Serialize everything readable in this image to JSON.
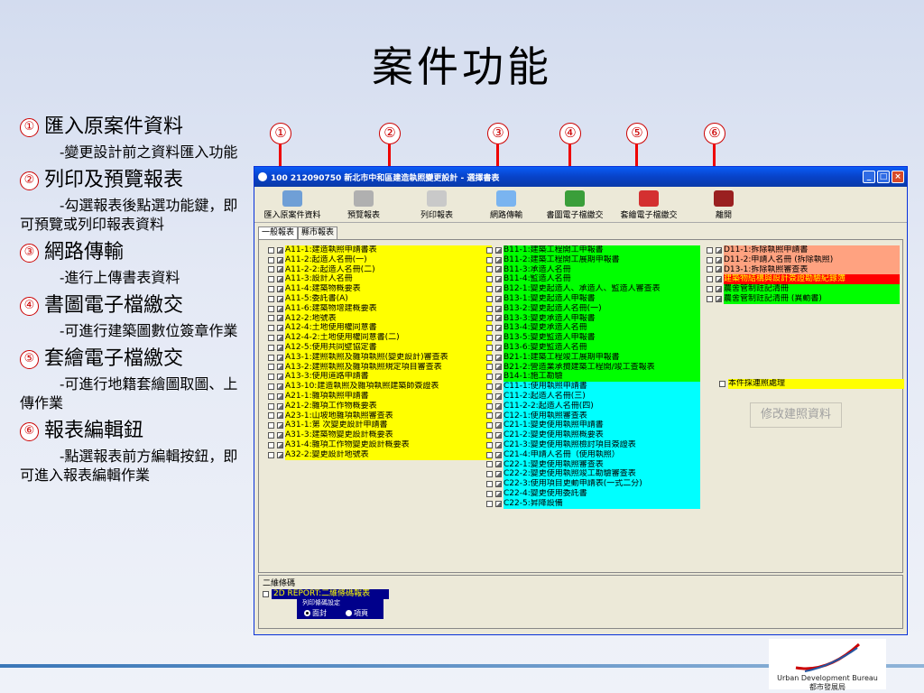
{
  "slide": {
    "title": "案件功能"
  },
  "notes": [
    {
      "num": "①",
      "heading": "匯入原案件資料",
      "desc": "-變更設計前之資料匯入功能"
    },
    {
      "num": "②",
      "heading": "列印及預覽報表",
      "desc": "-勾選報表後點選功能鍵，即可預覽或列印報表資料"
    },
    {
      "num": "③",
      "heading": "網路傳輸",
      "desc": "-進行上傳書表資料"
    },
    {
      "num": "④",
      "heading": "書圖電子檔繳交",
      "desc": "-可進行建築圖數位簽章作業"
    },
    {
      "num": "⑤",
      "heading": "套繪電子檔繳交",
      "desc": "-可進行地籍套繪圖取圖、上傳作業"
    },
    {
      "num": "⑥",
      "heading": "報表編輯鈕",
      "desc": "-點選報表前方編輯按鈕，即可進入報表編輯作業"
    }
  ],
  "callouts": [
    "①",
    "②",
    "③",
    "④",
    "⑤",
    "⑥"
  ],
  "window": {
    "title": "100 212090750 新北市中和區建造執照變更設計 - 選擇書表",
    "toolbar": [
      "匯入原案件資料",
      "預覽報表",
      "列印報表",
      "網路傳輸",
      "書圖電子檔繳交",
      "套繪電子檔繳交",
      "離開"
    ],
    "tabs": [
      "一般報表",
      "縣市報表"
    ],
    "col1": [
      {
        "text": "A11-1:建造執照申請書表",
        "color": "yellow"
      },
      {
        "text": "A11-2:起造人名冊(一)",
        "color": "yellow"
      },
      {
        "text": "A11-2-2:起造人名冊(二)",
        "color": "yellow"
      },
      {
        "text": "A11-3:設計人名冊",
        "color": "yellow"
      },
      {
        "text": "A11-4:建築物概要表",
        "color": "yellow"
      },
      {
        "text": "A11-5:委託書(A)",
        "color": "yellow"
      },
      {
        "text": "A11-6:建築物增建概要表",
        "color": "yellow"
      },
      {
        "text": "A12-2:地號表",
        "color": "yellow"
      },
      {
        "text": "A12-4:土地使用權同意書",
        "color": "yellow"
      },
      {
        "text": "A12-4-2:土地使用權同意書(二)",
        "color": "yellow"
      },
      {
        "text": "A12-5:使用共同壁協定書",
        "color": "yellow"
      },
      {
        "text": "A13-1:建照執照及雜項執照(變更設計)審查表",
        "color": "yellow"
      },
      {
        "text": "A13-2:建照執照及雜項執照規定項目審查表",
        "color": "yellow"
      },
      {
        "text": "A13-3:使用道路申請書",
        "color": "yellow"
      },
      {
        "text": "A13-10:建造執照及雜項執照建築師簽證表",
        "color": "yellow"
      },
      {
        "text": "A21-1:雜項執照申請書",
        "color": "yellow"
      },
      {
        "text": "A21-2:雜項工作物概要表",
        "color": "yellow"
      },
      {
        "text": "A23-1:山坡地雜項執照審查表",
        "color": "yellow"
      },
      {
        "text": "A31-1:第 次變更設計申請書",
        "color": "yellow"
      },
      {
        "text": "A31-3:建築物變更設計概要表",
        "color": "yellow"
      },
      {
        "text": "A31-4:雜項工作物變更設計概要表",
        "color": "yellow"
      },
      {
        "text": "A32-2:變更設計地號表",
        "color": "yellow"
      }
    ],
    "col2": [
      {
        "text": "B11-1:建築工程開工申報書",
        "color": "green"
      },
      {
        "text": "B11-2:建築工程開工展期申報書",
        "color": "green"
      },
      {
        "text": "B11-3:承造人名冊",
        "color": "green"
      },
      {
        "text": "B11-4:監造人名冊",
        "color": "green"
      },
      {
        "text": "B12-1:變更起造人、承造人、監造人審查表",
        "color": "green"
      },
      {
        "text": "B13-1:變更起造人申報書",
        "color": "green"
      },
      {
        "text": "B13-2:變更起造人名冊(一)",
        "color": "green"
      },
      {
        "text": "B13-3:變更承造人申報書",
        "color": "green"
      },
      {
        "text": "B13-4:變更承造人名冊",
        "color": "green"
      },
      {
        "text": "B13-5:變更監造人申報書",
        "color": "green"
      },
      {
        "text": "B13-6:變更監造人名冊",
        "color": "green"
      },
      {
        "text": "B21-1:建築工程竣工展期申報書",
        "color": "green"
      },
      {
        "text": "B21-2:營造業承攬建築工程開/竣工查報表",
        "color": "green"
      },
      {
        "text": "B14-1:施工勘驗",
        "color": "green"
      },
      {
        "text": "C11-1:使用執照申請書",
        "color": "cyan"
      },
      {
        "text": "C11-2:起造人名冊(三)",
        "color": "cyan"
      },
      {
        "text": "C11-2-2:起造人名冊(四)",
        "color": "cyan"
      },
      {
        "text": "C12-1:使用執照審查表",
        "color": "cyan"
      },
      {
        "text": "C21-1:變更使用執照申請書",
        "color": "cyan"
      },
      {
        "text": "C21-2:變更使用執照概要表",
        "color": "cyan"
      },
      {
        "text": "C21-3:變更使用執照檢討項目簽證表",
        "color": "cyan"
      },
      {
        "text": "C21-4:申請人名冊（使用執照）",
        "color": "cyan"
      },
      {
        "text": "C22-1:變更使用執照審查表",
        "color": "cyan"
      },
      {
        "text": "C22-2:變更使用執照竣工勘驗審查表",
        "color": "cyan"
      },
      {
        "text": "C22-3:使用項目更動申請表(一式二分)",
        "color": "cyan"
      },
      {
        "text": "C22-4:變更使用委託書",
        "color": "cyan"
      },
      {
        "text": "C22-5:昇降設備",
        "color": "cyan"
      }
    ],
    "col3": [
      {
        "text": "D11-1:拆除執照申請書",
        "color": "salmon"
      },
      {
        "text": "D11-2:申請人名冊 (拆除執照)",
        "color": "salmon"
      },
      {
        "text": "D13-1:拆除執照審查表",
        "color": "salmon"
      },
      {
        "text": "建築物結構與設計簽證勘驗紀錄簿",
        "color": "red"
      },
      {
        "text": "農舍管制註記清冊",
        "color": "green"
      },
      {
        "text": "農舍管制註記清冊 (異動書)",
        "color": "green"
      }
    ],
    "extra_check": "本件採連照處理",
    "modify_button": "修改建照資料",
    "qr": {
      "title": "二維條碼",
      "item": "2D REPORT:二維條碼報表",
      "options_caption": "列印條碼設定",
      "opt1": "面封",
      "opt2": "項頁"
    }
  },
  "logo": {
    "en": "Urban Development Bureau",
    "zh": "都市發展局"
  }
}
